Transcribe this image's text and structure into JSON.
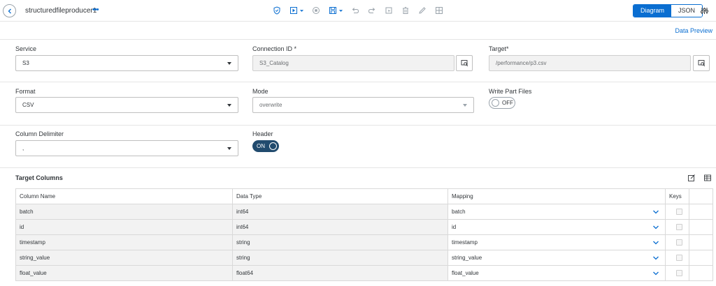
{
  "header": {
    "title": "structuredfileproducer1",
    "view_toggle": {
      "diagram": "Diagram",
      "json": "JSON"
    }
  },
  "links": {
    "data_preview": "Data Preview"
  },
  "form": {
    "service": {
      "label": "Service",
      "value": "S3"
    },
    "connection_id": {
      "label": "Connection ID *",
      "value": "S3_Catalog"
    },
    "target": {
      "label": "Target*",
      "value": "/performance/p3.csv"
    },
    "format": {
      "label": "Format",
      "value": "CSV"
    },
    "mode": {
      "label": "Mode",
      "value": "overwrite"
    },
    "write_part_files": {
      "label": "Write Part Files",
      "state": "OFF"
    },
    "column_delimiter": {
      "label": "Column Delimiter",
      "value": ","
    },
    "header": {
      "label": "Header",
      "state": "ON"
    }
  },
  "target_columns": {
    "title": "Target Columns",
    "columns": [
      "Column Name",
      "Data Type",
      "Mapping",
      "Keys"
    ],
    "rows": [
      {
        "name": "batch",
        "type": "int64",
        "mapping": "batch"
      },
      {
        "name": "id",
        "type": "int64",
        "mapping": "id"
      },
      {
        "name": "timestamp",
        "type": "string",
        "mapping": "timestamp"
      },
      {
        "name": "string_value",
        "type": "string",
        "mapping": "string_value"
      },
      {
        "name": "float_value",
        "type": "float64",
        "mapping": "float_value"
      }
    ]
  },
  "colors": {
    "accent": "#0a6ed1",
    "toggle_on": "#214b6e",
    "readonly_bg": "#f2f2f2"
  },
  "icons": [
    "back-icon",
    "more-icon",
    "validate-icon",
    "run-icon",
    "stop-icon",
    "save-icon",
    "undo-icon",
    "redo-icon",
    "select-icon",
    "delete-icon",
    "edit-icon",
    "layout-icon",
    "settings-icon",
    "browse-icon",
    "edit-columns-icon",
    "columns-icon",
    "chevron-down-icon"
  ]
}
